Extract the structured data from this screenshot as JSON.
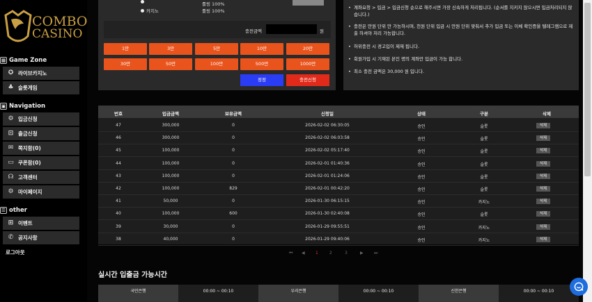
{
  "sidebar": {
    "logo_line1": "COMBO",
    "logo_line2": "CASINO",
    "sections": [
      {
        "title": "Game Zone",
        "icon": "grid-icon",
        "items": [
          {
            "label": "라이브카지노",
            "icon": "chip-icon"
          },
          {
            "label": "슬롯게임",
            "icon": "slot-icon"
          }
        ]
      },
      {
        "title": "Navigation",
        "icon": "nav-icon",
        "items": [
          {
            "label": "입금신청",
            "icon": "deposit-icon"
          },
          {
            "label": "출금신청",
            "icon": "withdraw-icon"
          },
          {
            "label": "쪽지함(0)",
            "icon": "mail-icon"
          },
          {
            "label": "쿠폰함(0)",
            "icon": "coupon-icon"
          },
          {
            "label": "고객센터",
            "icon": "headset-icon"
          },
          {
            "label": "마이페이지",
            "icon": "gear-icon"
          }
        ]
      },
      {
        "title": "other",
        "icon": "menu-icon",
        "items": [
          {
            "label": "이벤트",
            "icon": "gift-icon"
          },
          {
            "label": "공지사항",
            "icon": "megaphone-icon"
          }
        ]
      }
    ],
    "logout": "로그아웃"
  },
  "deposit_form": {
    "radio_options": [
      "카지노"
    ],
    "rolling_texts": [
      "롤링 100%",
      "롤링 100%"
    ],
    "amount_label": "충전금액",
    "amount_unit": "원",
    "amount_buttons": [
      "1만",
      "3만",
      "5만",
      "10만",
      "20만",
      "30만",
      "50만",
      "100만",
      "500만",
      "1000만"
    ],
    "reset_label": "정정",
    "apply_label": "충전신청"
  },
  "notices": [
    "계좌요청 > 입금 > 입금신청 순으로 해주시면 가장 신속하게 처리됩니다. (순서를 지키지 않으시면 입금처리되지 않습니다.)",
    "충전은 만원 단위 만 가능하시며, 천원 단위 입금 시 만원 단위 맞춰서 추가 입금 또는 이체 확인증을 텔레그램으로 제출 하셔야 처리 가능합니다.",
    "허위충전 시 경고입이 제재 됩니다.",
    "회원가입 시 기재된 본인 명의 계좌만 입금이 가능 합니다.",
    "최소 충전 금액은 30,000 원 입니다."
  ],
  "table": {
    "headers": [
      "번호",
      "입금금액",
      "보유금액",
      "신청일",
      "상태",
      "구분",
      "삭제"
    ],
    "delete_label": "삭제",
    "rows": [
      [
        "47",
        "300,000",
        "0",
        "2026-02-02 06:30:05",
        "승인",
        "슬롯"
      ],
      [
        "46",
        "300,000",
        "0",
        "2026-02-02 06:03:58",
        "승인",
        "슬롯"
      ],
      [
        "45",
        "100,000",
        "0",
        "2026-02-02 05:17:40",
        "승인",
        "슬롯"
      ],
      [
        "44",
        "100,000",
        "0",
        "2026-02-01 01:40:36",
        "승인",
        "슬롯"
      ],
      [
        "43",
        "100,000",
        "0",
        "2026-02-01 01:24:06",
        "승인",
        "슬롯"
      ],
      [
        "42",
        "100,000",
        "829",
        "2026-02-01 00:42:20",
        "승인",
        "슬롯"
      ],
      [
        "41",
        "50,000",
        "0",
        "2026-01-30 06:15:15",
        "승인",
        "카지노"
      ],
      [
        "40",
        "100,000",
        "600",
        "2026-01-30 02:40:08",
        "승인",
        "슬롯"
      ],
      [
        "39",
        "30,000",
        "0",
        "2026-01-29 09:55:51",
        "승인",
        "카지노"
      ],
      [
        "38",
        "40,000",
        "0",
        "2026-01-29 09:40:06",
        "승인",
        "카지노"
      ]
    ]
  },
  "pager": [
    "⏮",
    "◀",
    "1",
    "2",
    "3",
    "▶",
    "⏭"
  ],
  "bank_hours": {
    "title": "실시간 입출금 가능시간",
    "cells": [
      "국민은행",
      "00:00 ~ 00:10",
      "우리은행",
      "00:00 ~ 00:10",
      "신한은행",
      "00:00 ~ 00:10"
    ]
  },
  "colors": {
    "accent": "#e9541d",
    "reset": "#2b3cf5",
    "apply": "#e22a1b",
    "chat": "#1d6dde",
    "logo": "#c9a043"
  }
}
